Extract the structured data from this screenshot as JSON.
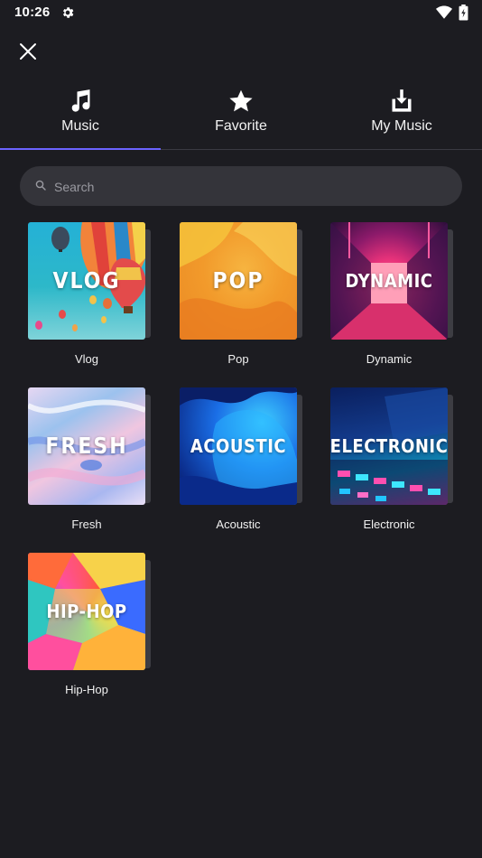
{
  "status_bar": {
    "time": "10:26"
  },
  "tabs": [
    {
      "label": "Music",
      "icon": "music-note-icon",
      "active": true
    },
    {
      "label": "Favorite",
      "icon": "star-icon",
      "active": false
    },
    {
      "label": "My Music",
      "icon": "download-icon",
      "active": false
    }
  ],
  "colors": {
    "accent": "#6b63ff",
    "background": "#1c1c21",
    "search_bg": "#34343a"
  },
  "search": {
    "placeholder": "Search",
    "value": ""
  },
  "genres": [
    {
      "name": "Vlog",
      "cover_text": "VLOG"
    },
    {
      "name": "Pop",
      "cover_text": "POP"
    },
    {
      "name": "Dynamic",
      "cover_text": "DYNAMIC"
    },
    {
      "name": "Fresh",
      "cover_text": "FRESH"
    },
    {
      "name": "Acoustic",
      "cover_text": "ACOUSTIC"
    },
    {
      "name": "Electronic",
      "cover_text": "ELECTRONIC"
    },
    {
      "name": "Hip-Hop",
      "cover_text": "HIP-HOP"
    }
  ]
}
